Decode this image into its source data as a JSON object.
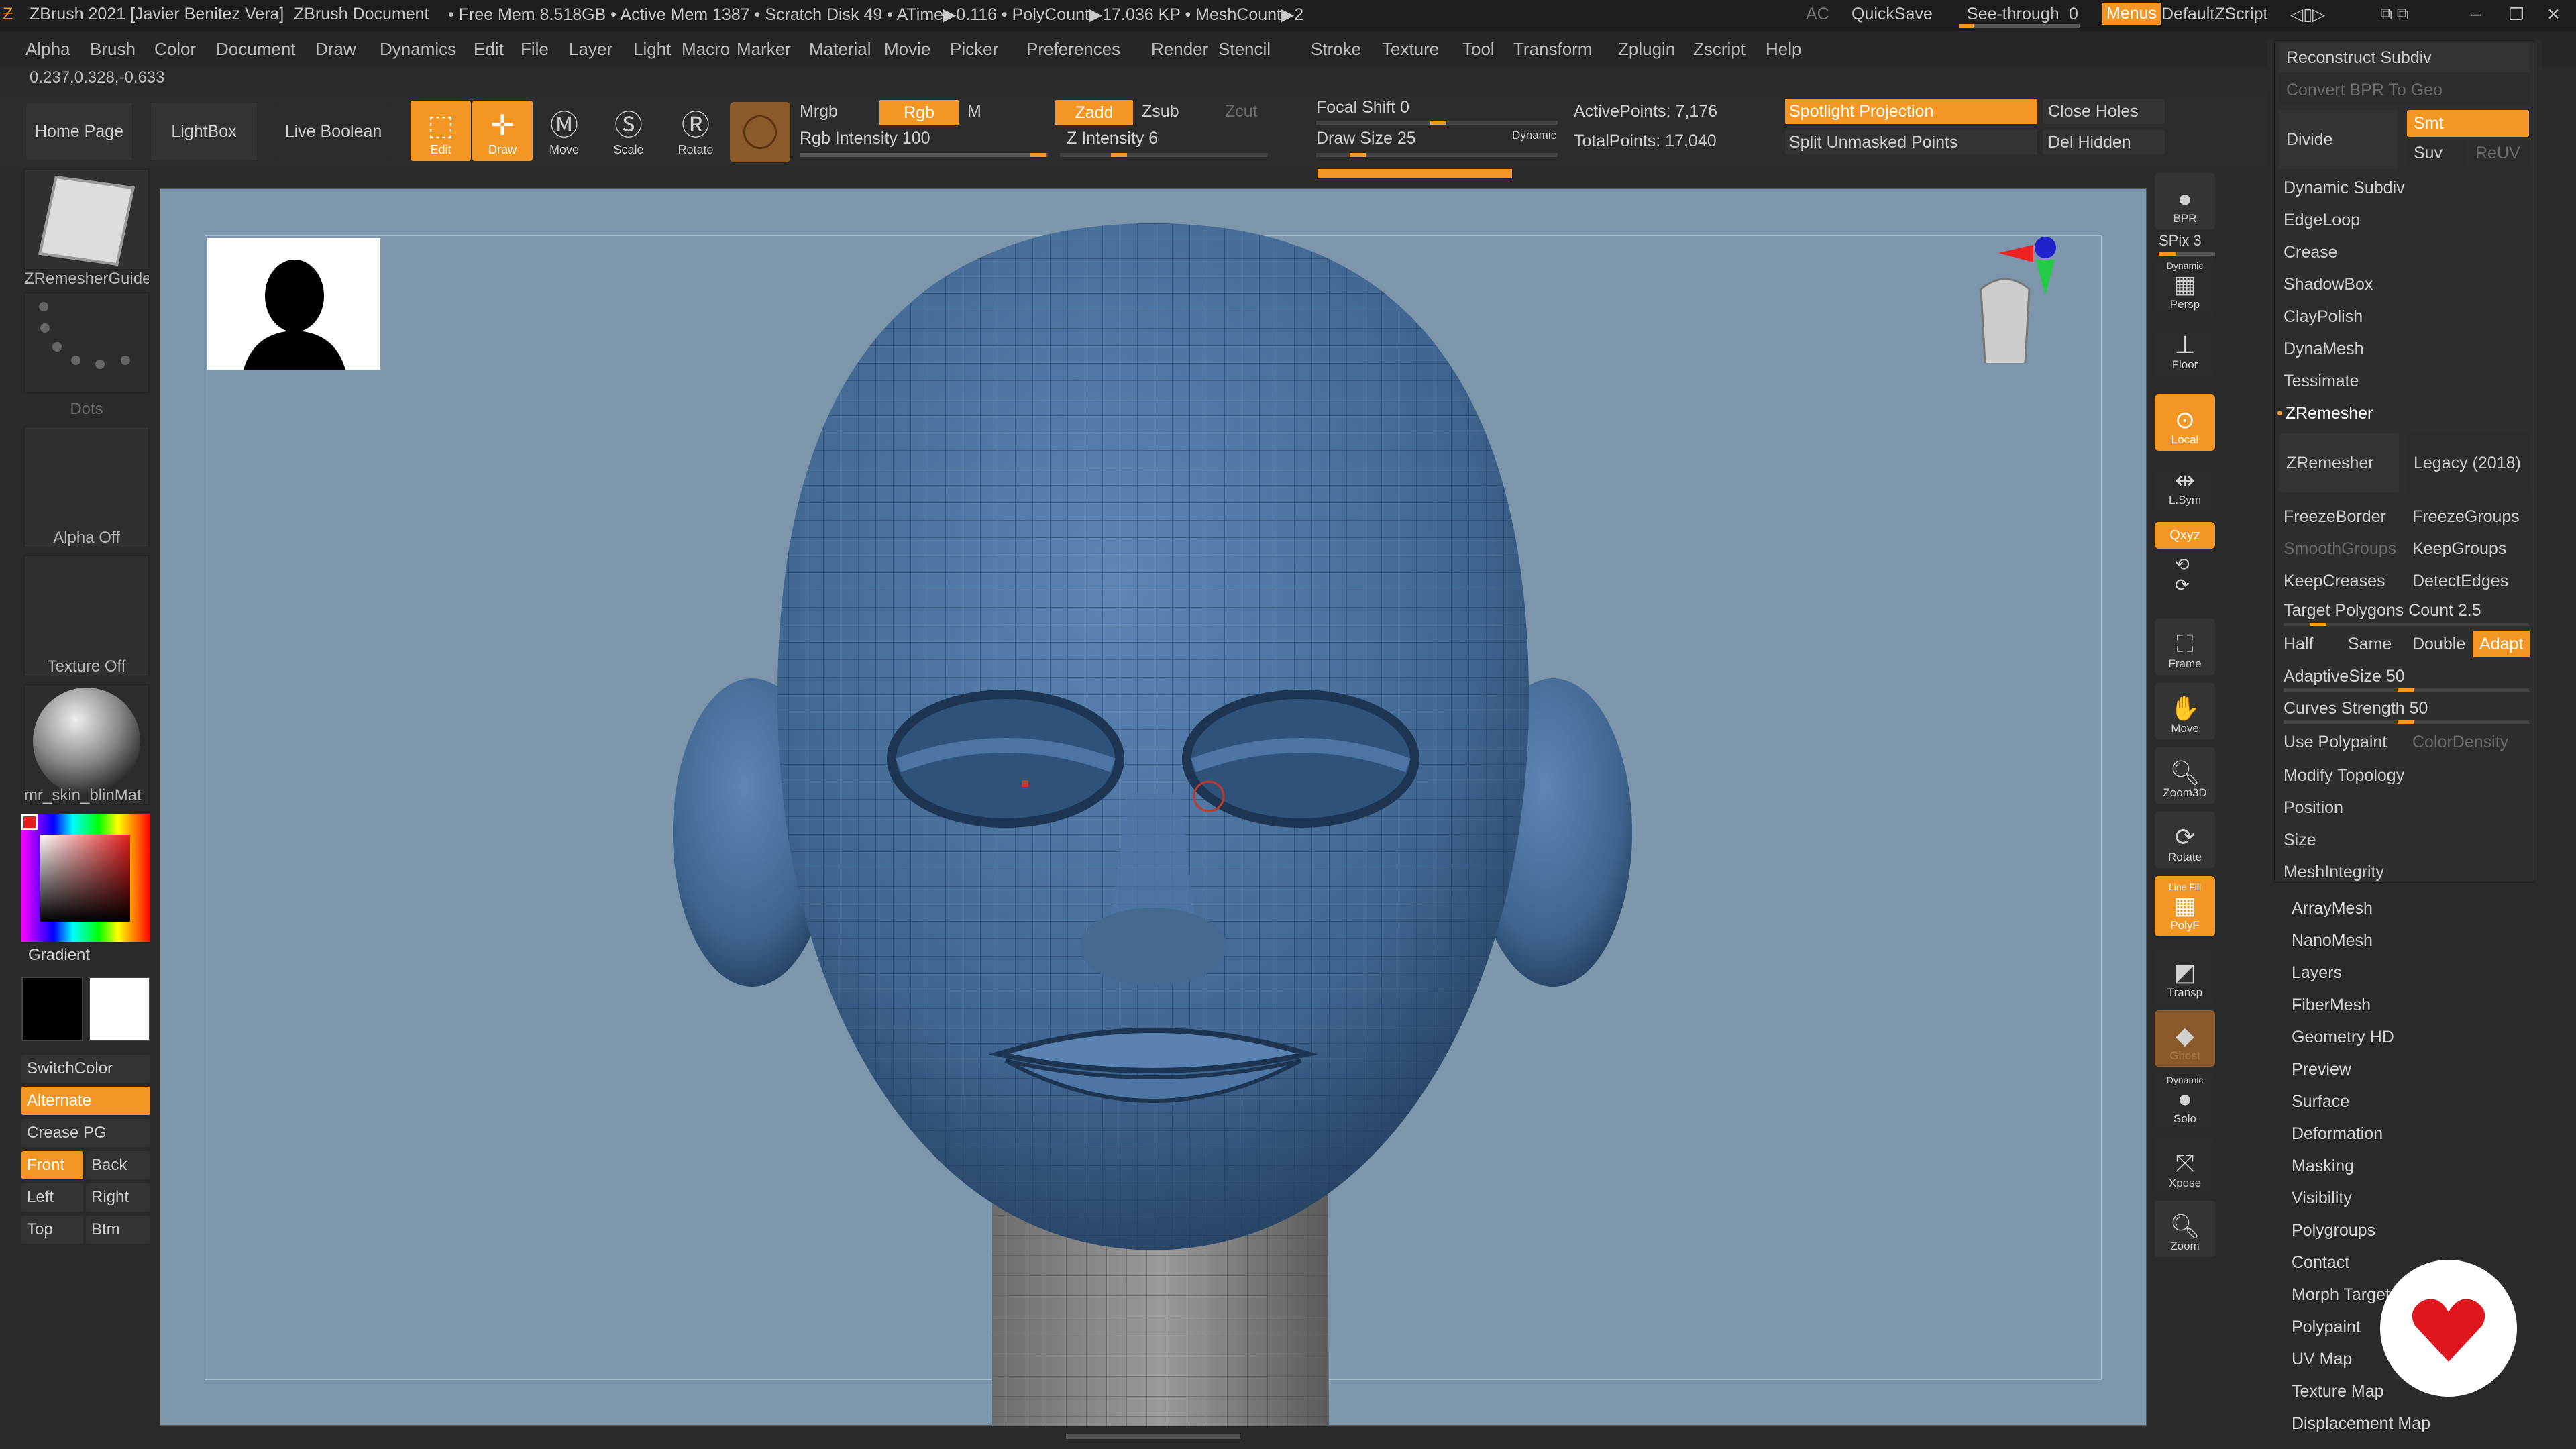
{
  "titlebar": {
    "app": "ZBrush 2021 [Javier Benitez Vera]",
    "document": "ZBrush Document",
    "stats": "• Free Mem 8.518GB • Active Mem 1387 • Scratch Disk 49 • ATime▶0.116 • PolyCount▶17.036 KP • MeshCount▶2",
    "ac": "AC",
    "quicksave": "QuickSave",
    "seethrough": "See-through",
    "seethrough_val": "0",
    "menus": "Menus",
    "script": "DefaultZScript"
  },
  "menubar": [
    "Alpha",
    "Brush",
    "Color",
    "Document",
    "Draw",
    "Dynamics",
    "Edit",
    "File",
    "Layer",
    "Light",
    "Macro",
    "Marker",
    "Material",
    "Movie",
    "Picker",
    "Preferences",
    "Render",
    "Stencil",
    "Stroke",
    "Texture",
    "Tool",
    "Transform",
    "Zplugin",
    "Zscript",
    "Help"
  ],
  "coords": "0.237,0.328,-0.633",
  "toolbar": {
    "home": "Home Page",
    "lightbox": "LightBox",
    "liveboolean": "Live Boolean",
    "edit": "Edit",
    "draw": "Draw",
    "move": "Move",
    "scale": "Scale",
    "rotate": "Rotate",
    "mrgb": "Mrgb",
    "rgb": "Rgb",
    "m": "M",
    "rgb_intensity": "Rgb Intensity 100",
    "zadd": "Zadd",
    "zsub": "Zsub",
    "zcut": "Zcut",
    "z_intensity": "Z Intensity 6",
    "focal_shift": "Focal Shift 0",
    "draw_size": "Draw Size 25",
    "dynamic": "Dynamic",
    "active_points": "ActivePoints: 7,176",
    "total_points": "TotalPoints: 17,040",
    "spotlight": "Spotlight Projection",
    "split_unmasked": "Split Unmasked Points",
    "close_holes": "Close Holes",
    "del_hidden": "Del Hidden"
  },
  "leftshelf": {
    "brush_label": "ZRemesherGuide",
    "stroke_label": "Dots",
    "alpha_label": "Alpha Off",
    "texture_label": "Texture Off",
    "material_label": "mr_skin_blinMat",
    "gradient": "Gradient",
    "switchcolor": "SwitchColor",
    "alternate": "Alternate",
    "crease_pg": "Crease PG",
    "front": "Front",
    "back": "Back",
    "left": "Left",
    "right": "Right",
    "top": "Top",
    "btm": "Btm"
  },
  "rightshelf": {
    "bpr": "BPR",
    "spix": "SPix 3",
    "persp": "Persp",
    "dynamic": "Dynamic",
    "floor": "Floor",
    "local": "Local",
    "lsym": "L.Sym",
    "xyz": "Qxyz",
    "frame": "Frame",
    "move": "Move",
    "zoom3d": "Zoom3D",
    "rotate": "Rotate",
    "linefill": "Line Fill",
    "polyf": "PolyF",
    "transp": "Transp",
    "ghost": "Ghost",
    "solo_dynamic": "Dynamic",
    "solo": "Solo",
    "xpose": "Xpose",
    "zoom": "Zoom"
  },
  "geometry": {
    "reconstruct": "Reconstruct Subdiv",
    "convert_bpr": "Convert BPR To Geo",
    "divide": "Divide",
    "smt": "Smt",
    "suv": "Suv",
    "reuv": "ReUV",
    "items1": [
      "Dynamic Subdiv",
      "EdgeLoop",
      "Crease",
      "ShadowBox",
      "ClayPolish",
      "DynaMesh",
      "Tessimate"
    ],
    "zremesher_header": "ZRemesher",
    "zremesher_btn": "ZRemesher",
    "legacy": "Legacy (2018)",
    "freezeborder": "FreezeBorder",
    "freezegroups": "FreezeGroups",
    "smoothgroups": "SmoothGroups",
    "keepgroups": "KeepGroups",
    "keepcreases": "KeepCreases",
    "detectedges": "DetectEdges",
    "target_polys": "Target Polygons Count 2.5",
    "half": "Half",
    "same": "Same",
    "double": "Double",
    "adapt": "Adapt",
    "adaptive_size": "AdaptiveSize 50",
    "curves_strength": "Curves Strength 50",
    "use_polypaint": "Use Polypaint",
    "colordensity": "ColorDensity",
    "items2": [
      "Modify Topology",
      "Position",
      "Size",
      "MeshIntegrity"
    ]
  },
  "tool_menus": [
    "ArrayMesh",
    "NanoMesh",
    "Layers",
    "FiberMesh",
    "Geometry HD",
    "Preview",
    "Surface",
    "Deformation",
    "Masking",
    "Visibility",
    "Polygroups",
    "Contact",
    "Morph Target",
    "Polypaint",
    "UV Map",
    "Texture Map",
    "Displacement Map"
  ]
}
